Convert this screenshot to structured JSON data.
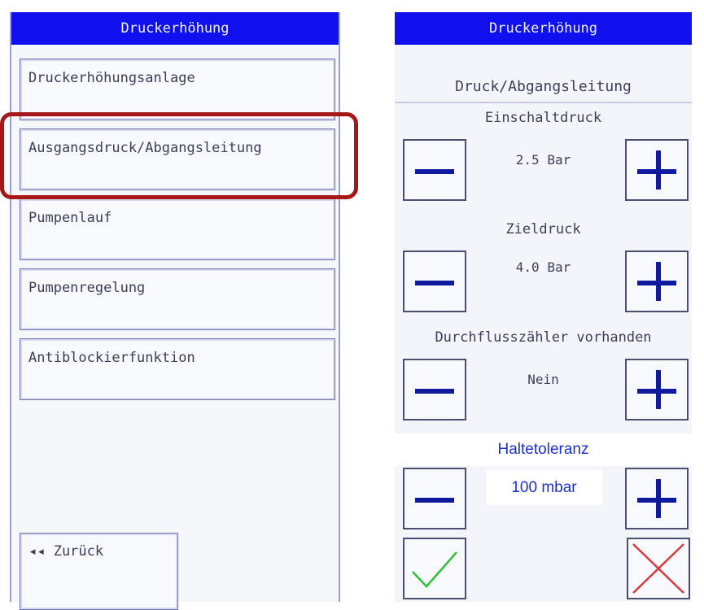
{
  "left": {
    "title": "Druckerhöhung",
    "items": [
      {
        "label": "Druckerhöhungsanlage"
      },
      {
        "label": "Ausgangsdruck/Abgangsleitung"
      },
      {
        "label": "Pumpenlauf"
      },
      {
        "label": "Pumpenregelung"
      },
      {
        "label": "Antiblockierfunktion"
      }
    ],
    "back_label": "◂◂ Zurück",
    "highlight_color": "#a61818"
  },
  "right": {
    "title": "Druckerhöhung",
    "subtitle": "Druck/Abgangsleitung",
    "settings": [
      {
        "label": "Einschaltdruck",
        "value": "2.5 Bar"
      },
      {
        "label": "Zieldruck",
        "value": "4.0 Bar"
      },
      {
        "label": "Durchflusszähler vorhanden",
        "value": "Nein"
      },
      {
        "label": "Haltetoleranz",
        "value": "100 mbar"
      }
    ],
    "confirm_color": "#2fbf3a",
    "cancel_color": "#d63a3a"
  },
  "colors": {
    "titlebar": "#1010ee",
    "accent_blue": "#0f1a9e"
  },
  "icons": [
    "minus-icon",
    "plus-icon",
    "check-icon",
    "close-icon",
    "double-arrow-left-icon"
  ]
}
